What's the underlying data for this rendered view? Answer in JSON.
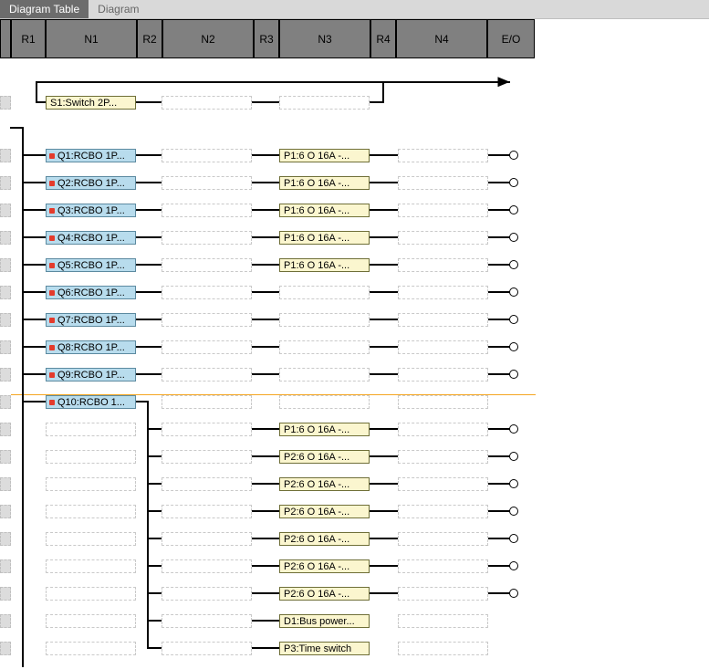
{
  "tabs": {
    "active": "Diagram Table",
    "inactive": "Diagram"
  },
  "ruler": {
    "r1": "R1",
    "n1": "N1",
    "r2": "R2",
    "n2": "N2",
    "r3": "R3",
    "n3": "N3",
    "r4": "R4",
    "n4": "N4",
    "eo": "E/O"
  },
  "switchRow": {
    "s1": "S1:Switch  2P..."
  },
  "rows": [
    {
      "n1": {
        "text": "Q1:RCBO  1P...",
        "type": "blue"
      },
      "n3": {
        "text": "P1:6 O 16A -...",
        "type": "yellow"
      },
      "term": true
    },
    {
      "n1": {
        "text": "Q2:RCBO  1P...",
        "type": "blue"
      },
      "n3": {
        "text": "P1:6 O 16A -...",
        "type": "yellow"
      },
      "term": true
    },
    {
      "n1": {
        "text": "Q3:RCBO  1P...",
        "type": "blue"
      },
      "n3": {
        "text": "P1:6 O 16A -...",
        "type": "yellow"
      },
      "term": true
    },
    {
      "n1": {
        "text": "Q4:RCBO  1P...",
        "type": "blue"
      },
      "n3": {
        "text": "P1:6 O 16A -...",
        "type": "yellow"
      },
      "term": true
    },
    {
      "n1": {
        "text": "Q5:RCBO  1P...",
        "type": "blue"
      },
      "n3": {
        "text": "P1:6 O 16A -...",
        "type": "yellow"
      },
      "term": true
    },
    {
      "n1": {
        "text": "Q6:RCBO  1P...",
        "type": "blue"
      },
      "n3": null,
      "term": true
    },
    {
      "n1": {
        "text": "Q7:RCBO  1P...",
        "type": "blue"
      },
      "n3": null,
      "term": true
    },
    {
      "n1": {
        "text": "Q8:RCBO  1P...",
        "type": "blue"
      },
      "n3": null,
      "term": true
    },
    {
      "n1": {
        "text": "Q9:RCBO  1P...",
        "type": "blue"
      },
      "n3": null,
      "term": true
    }
  ],
  "q10": {
    "n1": {
      "text": "Q10:RCBO  1...",
      "type": "blue"
    }
  },
  "subRows": [
    {
      "n3": {
        "text": "P1:6 O 16A -...",
        "type": "yellow"
      },
      "term": true
    },
    {
      "n3": {
        "text": "P2:6 O 16A -...",
        "type": "yellow"
      },
      "term": true
    },
    {
      "n3": {
        "text": "P2:6 O 16A -...",
        "type": "yellow"
      },
      "term": true
    },
    {
      "n3": {
        "text": "P2:6 O 16A -...",
        "type": "yellow"
      },
      "term": true
    },
    {
      "n3": {
        "text": "P2:6 O 16A -...",
        "type": "yellow"
      },
      "term": true
    },
    {
      "n3": {
        "text": "P2:6 O 16A -...",
        "type": "yellow"
      },
      "term": true
    },
    {
      "n3": {
        "text": "P2:6 O 16A -...",
        "type": "yellow"
      },
      "term": true
    },
    {
      "n3": {
        "text": "D1:Bus  power...",
        "type": "yellow"
      },
      "term": false
    },
    {
      "n3": {
        "text": "P3:Time switch",
        "type": "yellow"
      },
      "term": false
    }
  ],
  "layout": {
    "colX": {
      "n1": 50,
      "n2": 177,
      "n3": 306,
      "n4": 436
    },
    "blockW": 99,
    "busX": 25,
    "subBusX": 162,
    "termX": 563,
    "switchY": 112,
    "rowStartY": 170,
    "rowSpacing": 30,
    "orangeY": 432,
    "q10Y": 440,
    "subStartY": 470,
    "subSpacing": 30
  }
}
